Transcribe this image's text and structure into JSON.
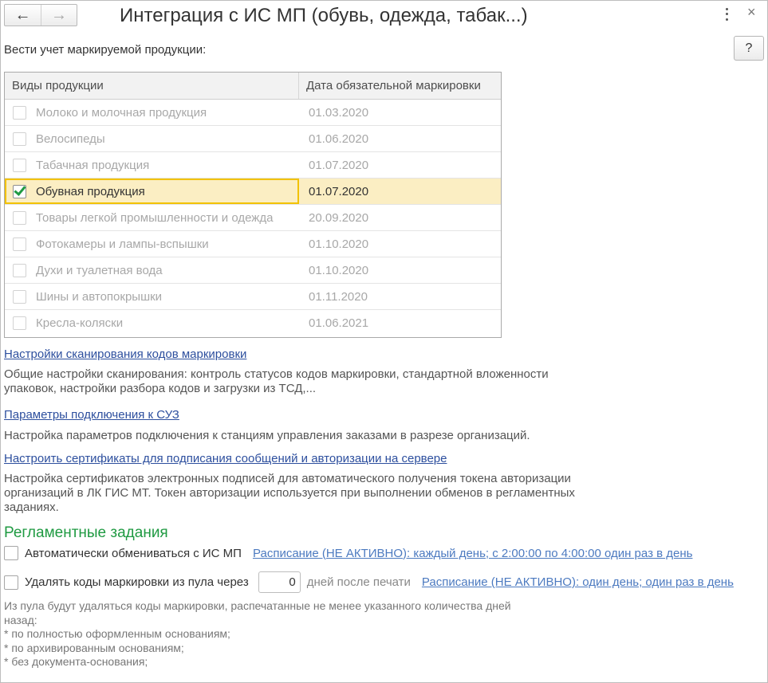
{
  "window": {
    "title": "Интеграция с ИС МП (обувь, одежда, табак...)",
    "back_icon": "←",
    "forward_icon": "→",
    "close_icon": "×",
    "help_label": "?"
  },
  "section_label": "Вести учет маркируемой продукции:",
  "table": {
    "columns": [
      "Виды продукции",
      "Дата обязательной маркировки"
    ],
    "rows": [
      {
        "name": "Молоко и молочная продукция",
        "date": "01.03.2020",
        "checked": false,
        "state": "disabled"
      },
      {
        "name": "Велосипеды",
        "date": "01.06.2020",
        "checked": false,
        "state": "disabled"
      },
      {
        "name": "Табачная продукция",
        "date": "01.07.2020",
        "checked": false,
        "state": "disabled"
      },
      {
        "name": "Обувная продукция",
        "date": "01.07.2020",
        "checked": true,
        "state": "selected"
      },
      {
        "name": "Товары легкой промышленности и одежда",
        "date": "20.09.2020",
        "checked": false,
        "state": "disabled"
      },
      {
        "name": "Фотокамеры и лампы-вспышки",
        "date": "01.10.2020",
        "checked": false,
        "state": "disabled"
      },
      {
        "name": "Духи и туалетная вода",
        "date": "01.10.2020",
        "checked": false,
        "state": "disabled"
      },
      {
        "name": "Шины и автопокрышки",
        "date": "01.11.2020",
        "checked": false,
        "state": "disabled"
      },
      {
        "name": "Кресла-коляски",
        "date": "01.06.2021",
        "checked": false,
        "state": "disabled"
      }
    ]
  },
  "links": {
    "scan_settings": {
      "label": "Настройки сканирования кодов маркировки",
      "desc_lines": [
        "Общие настройки сканирования: контроль статусов кодов маркировки, стандартной вложенности",
        "упаковок, настройки разбора кодов и загрузки из ТСД,..."
      ]
    },
    "suz": {
      "label": "Параметры подключения к СУЗ",
      "desc_lines": [
        "Настройка параметров подключения к станциям управления заказами в разрезе организаций."
      ]
    },
    "certs": {
      "label": "Настроить сертификаты для подписания сообщений и авторизации на сервере",
      "desc_lines": [
        "Настройка сертификатов электронных подписей для автоматического получения токена авторизации",
        "организаций в ЛК ГИС МТ. Токен авторизации используется при выполнении обменов в регламентных",
        "заданиях."
      ]
    }
  },
  "scheduled": {
    "heading": "Регламентные задания",
    "auto_exchange": {
      "label": "Автоматически обмениваться с ИС МП",
      "checked": false,
      "schedule": "Расписание (НЕ АКТИВНО): каждый день; с 2:00:00 по 4:00:00 один раз в день"
    },
    "delete_codes": {
      "label": "Удалять коды маркировки из пула через",
      "checked": false,
      "days_value": "0",
      "days_suffix": "дней после печати",
      "schedule": "Расписание (НЕ АКТИВНО): один день; один раз в день"
    },
    "note_lines": [
      "Из пула будут удаляться коды маркировки, распечатанные не менее указанного количества дней",
      "назад:",
      " * по полностью оформленным основаниям;",
      " * по архивированным основаниям;",
      " * без документа-основания;"
    ]
  }
}
